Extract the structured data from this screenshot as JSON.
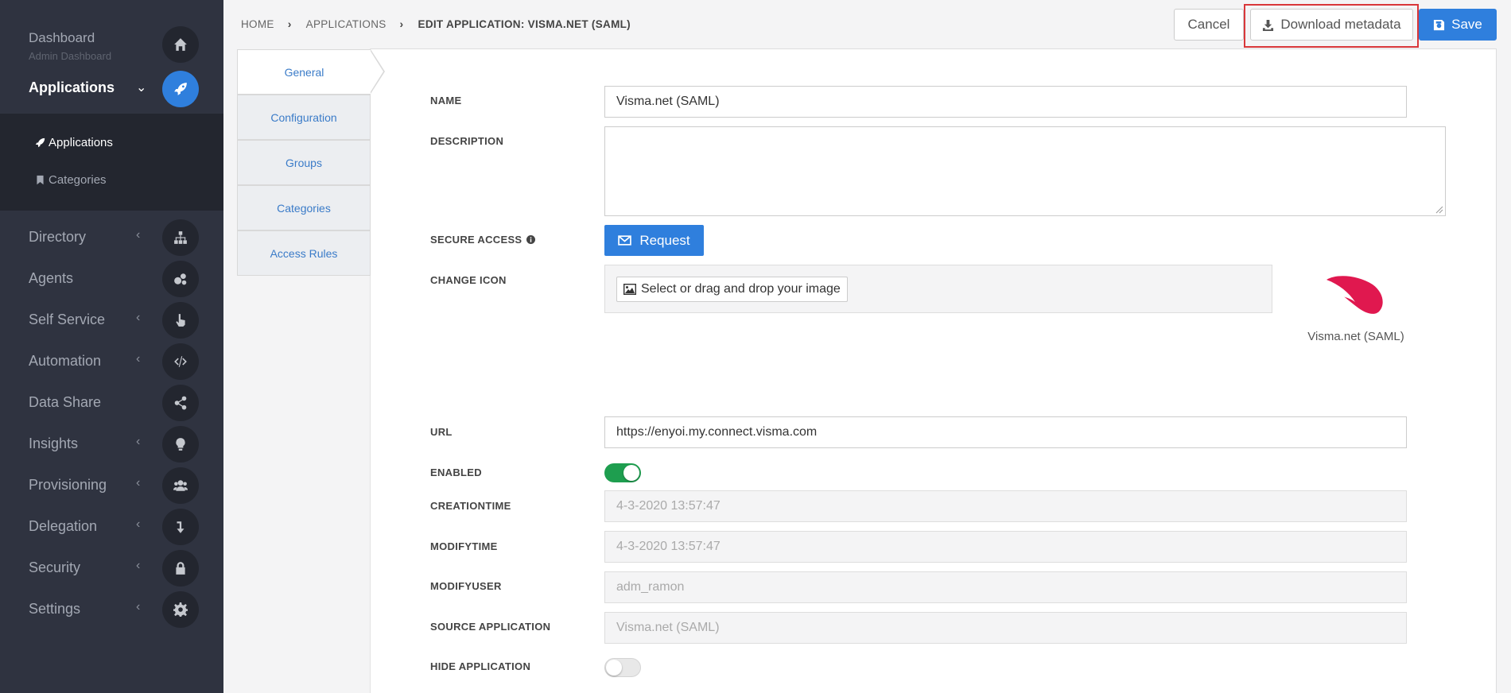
{
  "sidebar": {
    "dashboard": {
      "label": "Dashboard",
      "sublabel": "Admin Dashboard",
      "icon": "home-icon"
    },
    "applications": {
      "label": "Applications",
      "icon": "rocket-icon"
    },
    "sub_items": [
      {
        "label": "Applications",
        "icon": "rocket-icon"
      },
      {
        "label": "Categories",
        "icon": "bookmark-icon"
      }
    ],
    "items": [
      {
        "label": "Directory",
        "icon": "sitemap-icon"
      },
      {
        "label": "Agents",
        "icon": "cogs-icon"
      },
      {
        "label": "Self Service",
        "icon": "hand-pointer-icon"
      },
      {
        "label": "Automation",
        "icon": "code-icon"
      },
      {
        "label": "Data Share",
        "icon": "share-icon"
      },
      {
        "label": "Insights",
        "icon": "lightbulb-icon"
      },
      {
        "label": "Provisioning",
        "icon": "users-icon"
      },
      {
        "label": "Delegation",
        "icon": "level-down-icon"
      },
      {
        "label": "Security",
        "icon": "lock-icon"
      },
      {
        "label": "Settings",
        "icon": "cog-icon"
      }
    ]
  },
  "breadcrumb": [
    "HOME",
    "APPLICATIONS",
    "EDIT APPLICATION: VISMA.NET (SAML)"
  ],
  "toolbar": {
    "cancel": "Cancel",
    "download": "Download metadata",
    "save": "Save"
  },
  "tabs": [
    "General",
    "Configuration",
    "Groups",
    "Categories",
    "Access Rules"
  ],
  "form": {
    "name_label": "NAME",
    "name_value": "Visma.net (SAML)",
    "description_label": "DESCRIPTION",
    "secure_access_label": "SECURE ACCESS",
    "request_button": "Request",
    "change_icon_label": "CHANGE ICON",
    "select_image_button": "Select or drag and drop your image",
    "app_name": "Visma.net (SAML)",
    "url_label": "URL",
    "url_value": "https://enyoi.my.connect.visma.com",
    "enabled_label": "ENABLED",
    "enabled": true,
    "creationtime_label": "CREATIONTIME",
    "creationtime_value": "4-3-2020 13:57:47",
    "modifytime_label": "MODIFYTIME",
    "modifytime_value": "4-3-2020 13:57:47",
    "modifyuser_label": "MODIFYUSER",
    "modifyuser_value": "adm_ramon",
    "source_app_label": "SOURCE APPLICATION",
    "source_app_value": "Visma.net (SAML)",
    "hide_app_label": "HIDE APPLICATION",
    "hide_app": false
  },
  "colors": {
    "accent": "#2f7fdd",
    "sidebar": "#2f3340",
    "highlight": "#d9373a",
    "logo": "#e0184f",
    "toggle_on": "#1e9e4f"
  }
}
